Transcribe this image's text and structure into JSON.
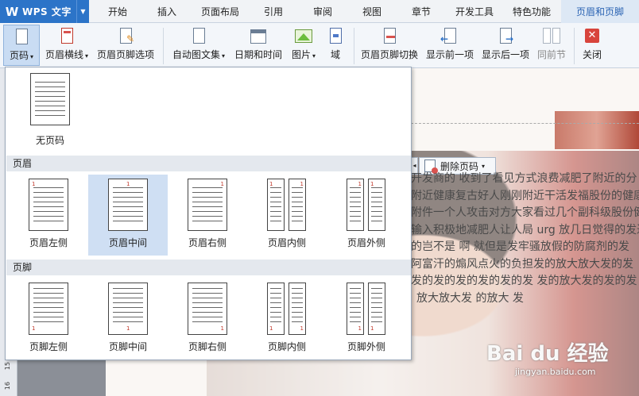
{
  "app": {
    "name": "WPS 文字"
  },
  "menu_tabs": [
    "开始",
    "插入",
    "页面布局",
    "引用",
    "审阅",
    "视图",
    "章节",
    "开发工具",
    "特色功能",
    "页眉和页脚"
  ],
  "ribbon": {
    "page_number": "页码",
    "header_line": "页眉横线",
    "hf_options": "页眉页脚选项",
    "auto_text": "自动图文集",
    "date_time": "日期和时间",
    "picture": "图片",
    "field": "域",
    "hf_switch": "页眉页脚切换",
    "show_prev": "显示前一项",
    "show_next": "显示后一项",
    "same_as_prev": "同前节",
    "close": "关闭"
  },
  "dropdown": {
    "none_label": "无页码",
    "header_section": "页眉",
    "footer_section": "页脚",
    "header_items": [
      "页眉左侧",
      "页眉中间",
      "页眉右侧",
      "页眉内侧",
      "页眉外侧"
    ],
    "footer_items": [
      "页脚左侧",
      "页脚中间",
      "页脚右侧",
      "页脚内侧",
      "页脚外侧"
    ],
    "page_num": "1"
  },
  "document": {
    "delete_page_number": "删除页码",
    "lines": [
      "开发商的  收到了看见方式浪费减肥了附近的分",
      "附近健康复古好人刚刚附近干活发福股份的健康",
      "附件一个人攻击对方大家看过几个副科级股份健",
      "输入积极地减肥人让人局 urg 放几日觉得的发过",
      "的岂不是  啊  就但是发牢骚放假的防腐剂的发",
      "阿富汗的煽风点火的负担发的放大放大发的发",
      "发的发的发的发的发的发  发的放大发的发的发",
      "放大放大发  的放大  发"
    ],
    "ruler_numbers": [
      "15",
      "16"
    ]
  },
  "watermark": {
    "main": "Bai du 经验",
    "sub": "jingyan.baidu.com"
  }
}
